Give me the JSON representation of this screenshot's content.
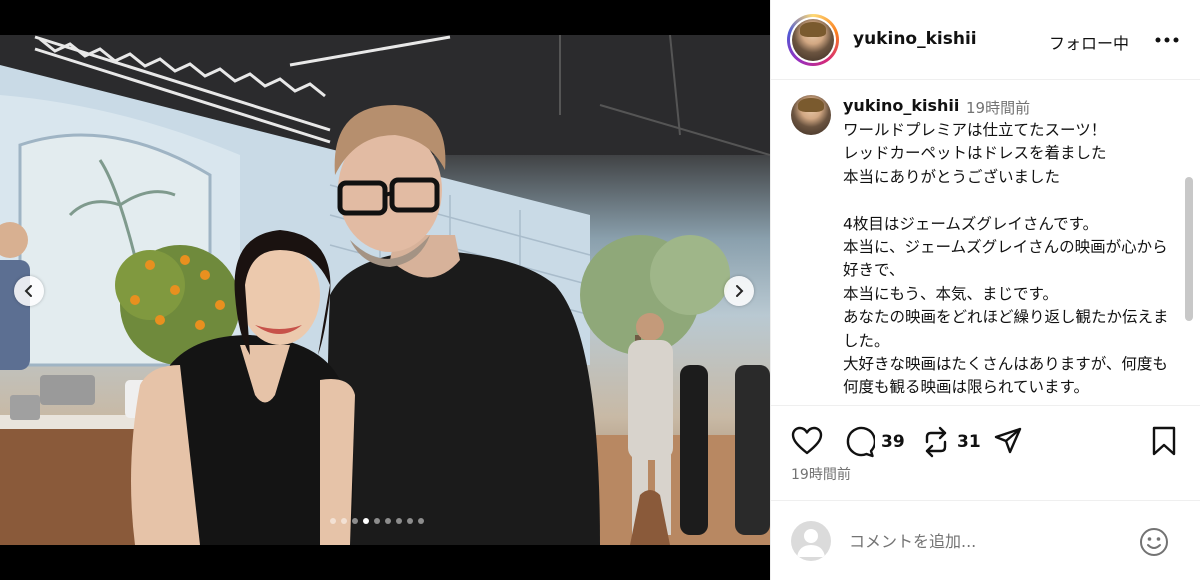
{
  "post": {
    "username": "yukino_kishii",
    "follow_status": "フォロー中",
    "caption": {
      "username": "yukino_kishii",
      "time_ago": "19時間前",
      "text": "ワールドプレミアは仕立てたスーツ！\nレッドカーペットはドレスを着ました\n本当にありがとうございました\n\n4枚目はジェームズグレイさんです。\n本当に、ジェームズグレイさんの映画が心から好きで、\n本当にもう、本気、まじです。\nあなたの映画をどれほど繰り返し観たか伝えました。\n大好きな映画はたくさんはありますが、何度も何度も観る映画は限られています。"
    },
    "actions": {
      "comment_count": "39",
      "repost_count": "31"
    },
    "timestamp": "19時間前",
    "comment_placeholder": "コメントを追加...",
    "carousel": {
      "total": 9,
      "active_index": 3
    }
  },
  "icons": {
    "like": "heart-icon",
    "comment": "comment-bubble-icon",
    "repost": "repost-icon",
    "share": "share-paper-plane-icon",
    "save": "bookmark-icon",
    "more": "more-dots-icon",
    "emoji": "smiley-icon",
    "prev": "chevron-left-icon",
    "next": "chevron-right-icon"
  },
  "colors": {
    "text_primary": "#111111",
    "text_secondary": "#737373",
    "divider": "#efefef"
  }
}
